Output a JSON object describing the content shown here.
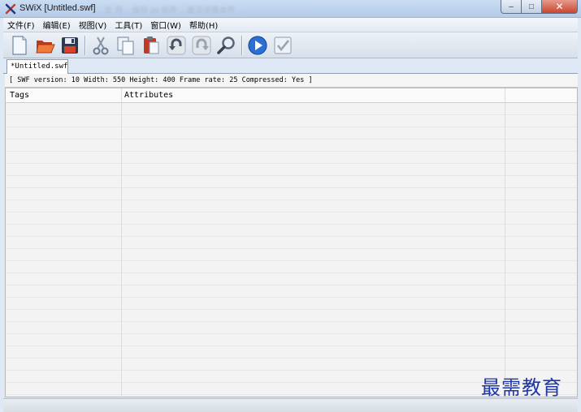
{
  "window": {
    "title": "SWiX [Untitled.swf]",
    "background_title_text": "...文 月 ...保存 ps 标件 ...激活详情本件 ...",
    "buttons": {
      "minimize": "–",
      "maximize": "□",
      "close": "✕"
    }
  },
  "menu": [
    {
      "label": "文件(F)"
    },
    {
      "label": "编辑(E)"
    },
    {
      "label": "视图(V)"
    },
    {
      "label": "工具(T)"
    },
    {
      "label": "窗口(W)"
    },
    {
      "label": "帮助(H)"
    }
  ],
  "toolbar": {
    "icons": [
      "new-document-icon",
      "open-folder-icon",
      "save-disk-icon",
      "cut-scissors-icon",
      "copy-icon",
      "paste-icon",
      "undo-icon",
      "redo-icon",
      "find-magnifier-icon",
      "play-icon",
      "validate-check-icon"
    ]
  },
  "tabs": [
    {
      "label": "*Untitled.swf",
      "active": true
    }
  ],
  "info_line": "[ SWF version: 10  Width: 550  Height: 400  Frame rate: 25  Compressed: Yes ]",
  "table": {
    "columns": [
      "Tags",
      "Attributes",
      ""
    ],
    "rows": []
  },
  "watermark": "最需教育",
  "colors": {
    "accent": "#2b6fd6",
    "close_button": "#c9452f",
    "watermark": "#1f36a8"
  }
}
